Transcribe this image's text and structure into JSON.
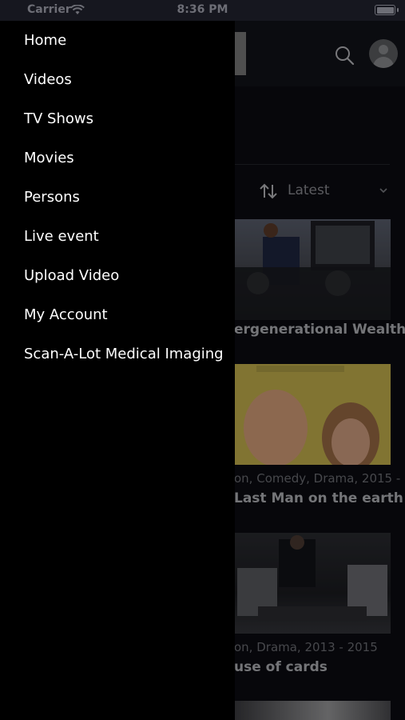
{
  "status_bar": {
    "carrier": "Carrier",
    "time": "8:36 PM"
  },
  "header": {
    "search_icon": "search-icon",
    "avatar_icon": "user-avatar-icon"
  },
  "sort": {
    "label": "Latest"
  },
  "cards": [
    {
      "meta": "",
      "title": "ergenerational Wealth"
    },
    {
      "meta": "on, Comedy, Drama, 2015 - ...",
      "title": "Last Man on the earth"
    },
    {
      "meta": "on, Drama, 2013 - 2015",
      "title": "use of cards"
    }
  ],
  "drawer": {
    "items": [
      {
        "label": "Home"
      },
      {
        "label": "Videos"
      },
      {
        "label": "TV Shows"
      },
      {
        "label": "Movies"
      },
      {
        "label": "Persons"
      },
      {
        "label": "Live event"
      },
      {
        "label": "Upload Video"
      },
      {
        "label": "My Account"
      },
      {
        "label": "Scan-A-Lot Medical Imaging"
      }
    ]
  },
  "colors": {
    "drawer_bg": "#000000",
    "page_bg": "#0b0c12",
    "header_bg": "#121319"
  }
}
